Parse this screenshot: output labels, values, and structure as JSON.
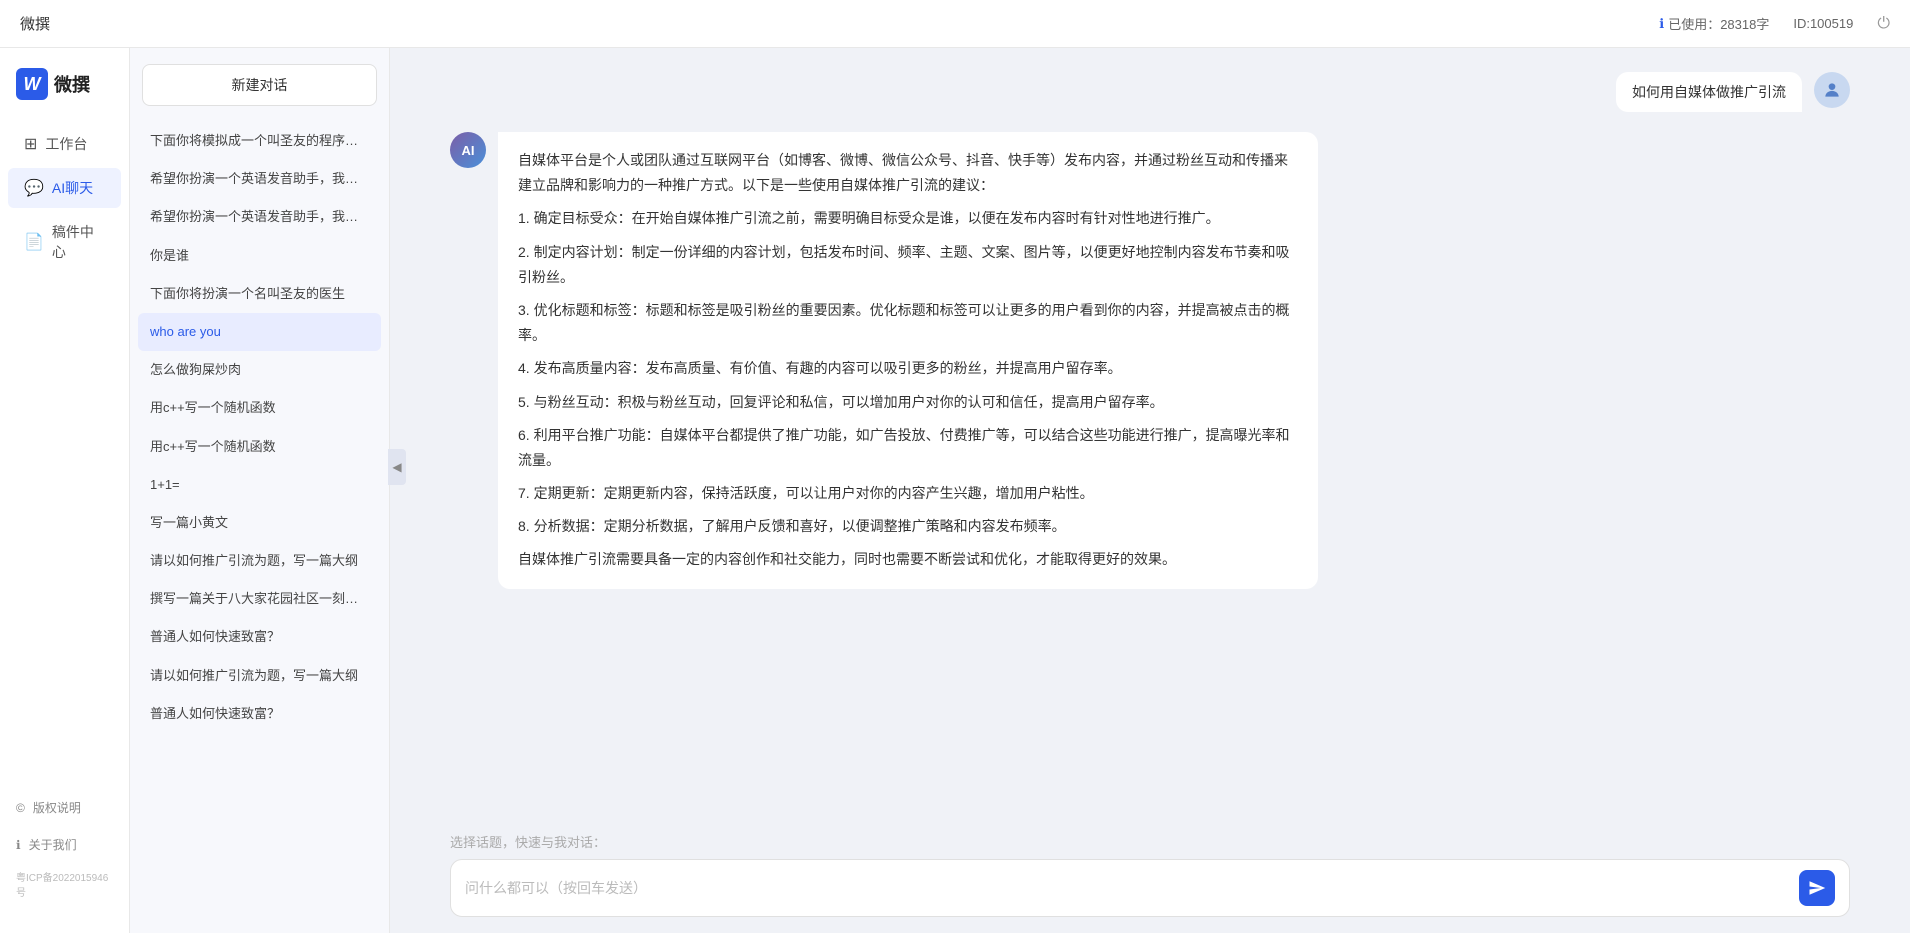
{
  "topbar": {
    "title": "微撰",
    "usage_label": "已使用：28318字",
    "id_label": "ID:100519",
    "usage_icon": "ℹ",
    "power_icon": "⏻"
  },
  "logo": {
    "w_letter": "W",
    "brand_name": "微撰"
  },
  "nav": {
    "items": [
      {
        "id": "workbench",
        "label": "工作台",
        "icon": "⊞"
      },
      {
        "id": "ai-chat",
        "label": "AI聊天",
        "icon": "💬",
        "active": true
      },
      {
        "id": "drafts",
        "label": "稿件中心",
        "icon": "📄"
      }
    ],
    "footer": [
      {
        "id": "copyright",
        "label": "版权说明",
        "icon": "©"
      },
      {
        "id": "about",
        "label": "关于我们",
        "icon": "ℹ"
      }
    ],
    "beian": "粤ICP备2022015946号"
  },
  "sidebar": {
    "new_btn_label": "新建对话",
    "history": [
      {
        "id": 1,
        "text": "下面你将模拟成一个叫圣友的程序员，我说..."
      },
      {
        "id": 2,
        "text": "希望你扮演一个英语发音助手，我提供给你..."
      },
      {
        "id": 3,
        "text": "希望你扮演一个英语发音助手，我提供给你..."
      },
      {
        "id": 4,
        "text": "你是谁"
      },
      {
        "id": 5,
        "text": "下面你将扮演一个名叫圣友的医生"
      },
      {
        "id": 6,
        "text": "who are you",
        "active": true
      },
      {
        "id": 7,
        "text": "怎么做狗屎炒肉"
      },
      {
        "id": 8,
        "text": "用c++写一个随机函数"
      },
      {
        "id": 9,
        "text": "用c++写一个随机函数"
      },
      {
        "id": 10,
        "text": "1+1="
      },
      {
        "id": 11,
        "text": "写一篇小黄文"
      },
      {
        "id": 12,
        "text": "请以如何推广引流为题，写一篇大纲"
      },
      {
        "id": 13,
        "text": "撰写一篇关于八大家花园社区一刻钟便民生..."
      },
      {
        "id": 14,
        "text": "普通人如何快速致富？"
      },
      {
        "id": 15,
        "text": "请以如何推广引流为题，写一篇大纲"
      },
      {
        "id": 16,
        "text": "普通人如何快速致富？"
      }
    ]
  },
  "chat": {
    "user_message": "如何用自媒体做推广引流",
    "ai_response": {
      "paragraphs": [
        "自媒体平台是个人或团队通过互联网平台（如博客、微博、微信公众号、抖音、快手等）发布内容，并通过粉丝互动和传播来建立品牌和影响力的一种推广方式。以下是一些使用自媒体推广引流的建议：",
        "1. 确定目标受众：在开始自媒体推广引流之前，需要明确目标受众是谁，以便在发布内容时有针对性地进行推广。",
        "2. 制定内容计划：制定一份详细的内容计划，包括发布时间、频率、主题、文案、图片等，以便更好地控制内容发布节奏和吸引粉丝。",
        "3. 优化标题和标签：标题和标签是吸引粉丝的重要因素。优化标题和标签可以让更多的用户看到你的内容，并提高被点击的概率。",
        "4. 发布高质量内容：发布高质量、有价值、有趣的内容可以吸引更多的粉丝，并提高用户留存率。",
        "5. 与粉丝互动：积极与粉丝互动，回复评论和私信，可以增加用户对你的认可和信任，提高用户留存率。",
        "6. 利用平台推广功能：自媒体平台都提供了推广功能，如广告投放、付费推广等，可以结合这些功能进行推广，提高曝光率和流量。",
        "7. 定期更新：定期更新内容，保持活跃度，可以让用户对你的内容产生兴趣，增加用户粘性。",
        "8. 分析数据：定期分析数据，了解用户反馈和喜好，以便调整推广策略和内容发布频率。",
        "自媒体推广引流需要具备一定的内容创作和社交能力，同时也需要不断尝试和优化，才能取得更好的效果。"
      ]
    },
    "quick_topics_label": "选择话题，快速与我对话：",
    "input_placeholder": "问什么都可以（按回车发送）",
    "send_icon": "➤"
  }
}
